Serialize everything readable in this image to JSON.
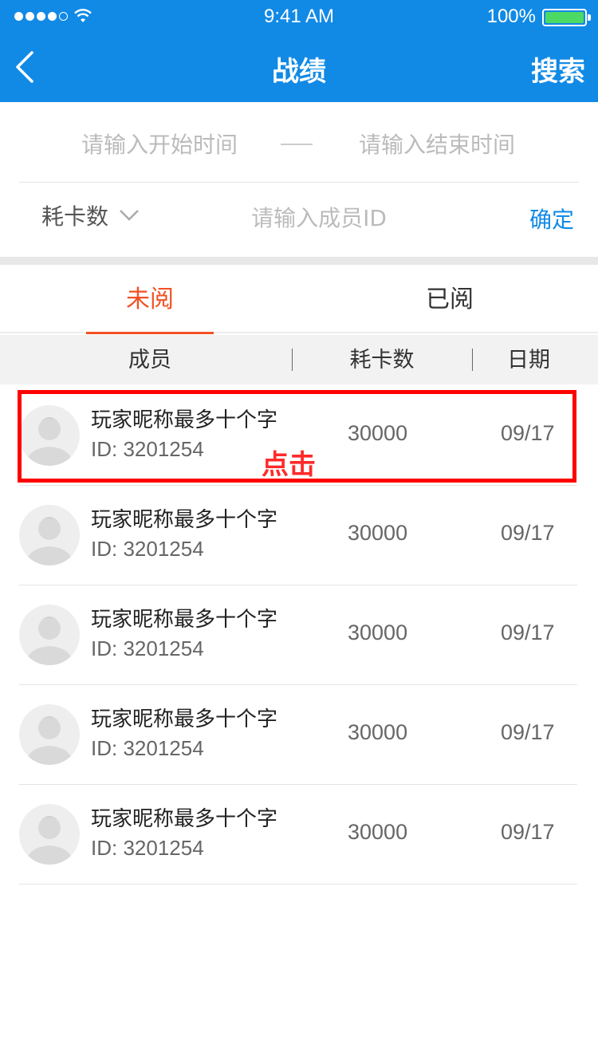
{
  "status_bar": {
    "time": "9:41 AM",
    "battery": "100%"
  },
  "nav": {
    "title": "战绩",
    "search_label": "搜索"
  },
  "filter": {
    "start_placeholder": "请输入开始时间",
    "end_placeholder": "请输入结束时间",
    "select_value": "耗卡数",
    "member_placeholder": "请输入成员ID",
    "confirm_label": "确定"
  },
  "tabs": [
    {
      "label": "未阅",
      "active": true
    },
    {
      "label": "已阅",
      "active": false
    }
  ],
  "table": {
    "headers": [
      "成员",
      "耗卡数",
      "日期"
    ],
    "rows": [
      {
        "nickname": "玩家昵称最多十个字",
        "id": "ID: 3201254",
        "cards": "30000",
        "date": "09/17"
      },
      {
        "nickname": "玩家昵称最多十个字",
        "id": "ID: 3201254",
        "cards": "30000",
        "date": "09/17"
      },
      {
        "nickname": "玩家昵称最多十个字",
        "id": "ID: 3201254",
        "cards": "30000",
        "date": "09/17"
      },
      {
        "nickname": "玩家昵称最多十个字",
        "id": "ID: 3201254",
        "cards": "30000",
        "date": "09/17"
      },
      {
        "nickname": "玩家昵称最多十个字",
        "id": "ID: 3201254",
        "cards": "30000",
        "date": "09/17"
      }
    ]
  },
  "annotation": {
    "label": "点击"
  },
  "colors": {
    "nav_bg": "#118ae6",
    "active_tab": "#f05123",
    "confirm": "#118ae6",
    "highlight": "#ff0000"
  }
}
